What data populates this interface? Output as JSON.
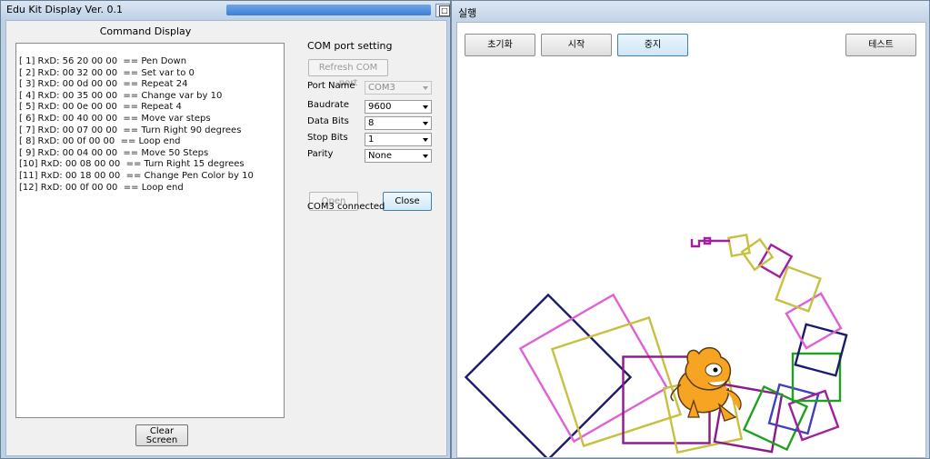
{
  "left_window": {
    "title": "Edu Kit Display Ver. 0.1",
    "close_glyph": "✕",
    "command_display_title": "Command Display",
    "commands": [
      "[ 1] RxD: 56 20 00 00  == Pen Down",
      "[ 2] RxD: 00 32 00 00  == Set var to 0",
      "[ 3] RxD: 00 0d 00 00  == Repeat 24",
      "[ 4] RxD: 00 35 00 00  == Change var by 10",
      "[ 5] RxD: 00 0e 00 00  == Repeat 4",
      "[ 6] RxD: 00 40 00 00  == Move var steps",
      "[ 7] RxD: 00 07 00 00  == Turn Right 90 degrees",
      "[ 8] RxD: 00 0f 00 00  == Loop end",
      "[ 9] RxD: 00 04 00 00  == Move 50 Steps",
      "[10] RxD: 00 08 00 00  == Turn Right 15 degrees",
      "[11] RxD: 00 18 00 00  == Change Pen Color by 10",
      "[12] RxD: 00 0f 00 00  == Loop end"
    ],
    "clear_button": {
      "line1": "Clear",
      "line2": "Screen"
    },
    "com_group": {
      "title": "COM port setting",
      "refresh_button": "Refresh COM port",
      "port_name_label": "Port Name",
      "port_name_value": "COM3",
      "baudrate_label": "Baudrate",
      "baudrate_value": "9600",
      "data_bits_label": "Data Bits",
      "data_bits_value": "8",
      "stop_bits_label": "Stop Bits",
      "stop_bits_value": "1",
      "parity_label": "Parity",
      "parity_value": "None",
      "open_button": "Open",
      "close_button": "Close"
    },
    "status": "COM3 connected"
  },
  "right_window": {
    "title": "실행",
    "buttons": {
      "init": "초기화",
      "start": "시작",
      "stop": "중지",
      "test": "테스트"
    },
    "pen_colors": [
      "#1a1a6e",
      "#e060d8",
      "#c8c040",
      "#8a1a8a",
      "#20a020",
      "#4040c0",
      "#a020a0"
    ]
  }
}
